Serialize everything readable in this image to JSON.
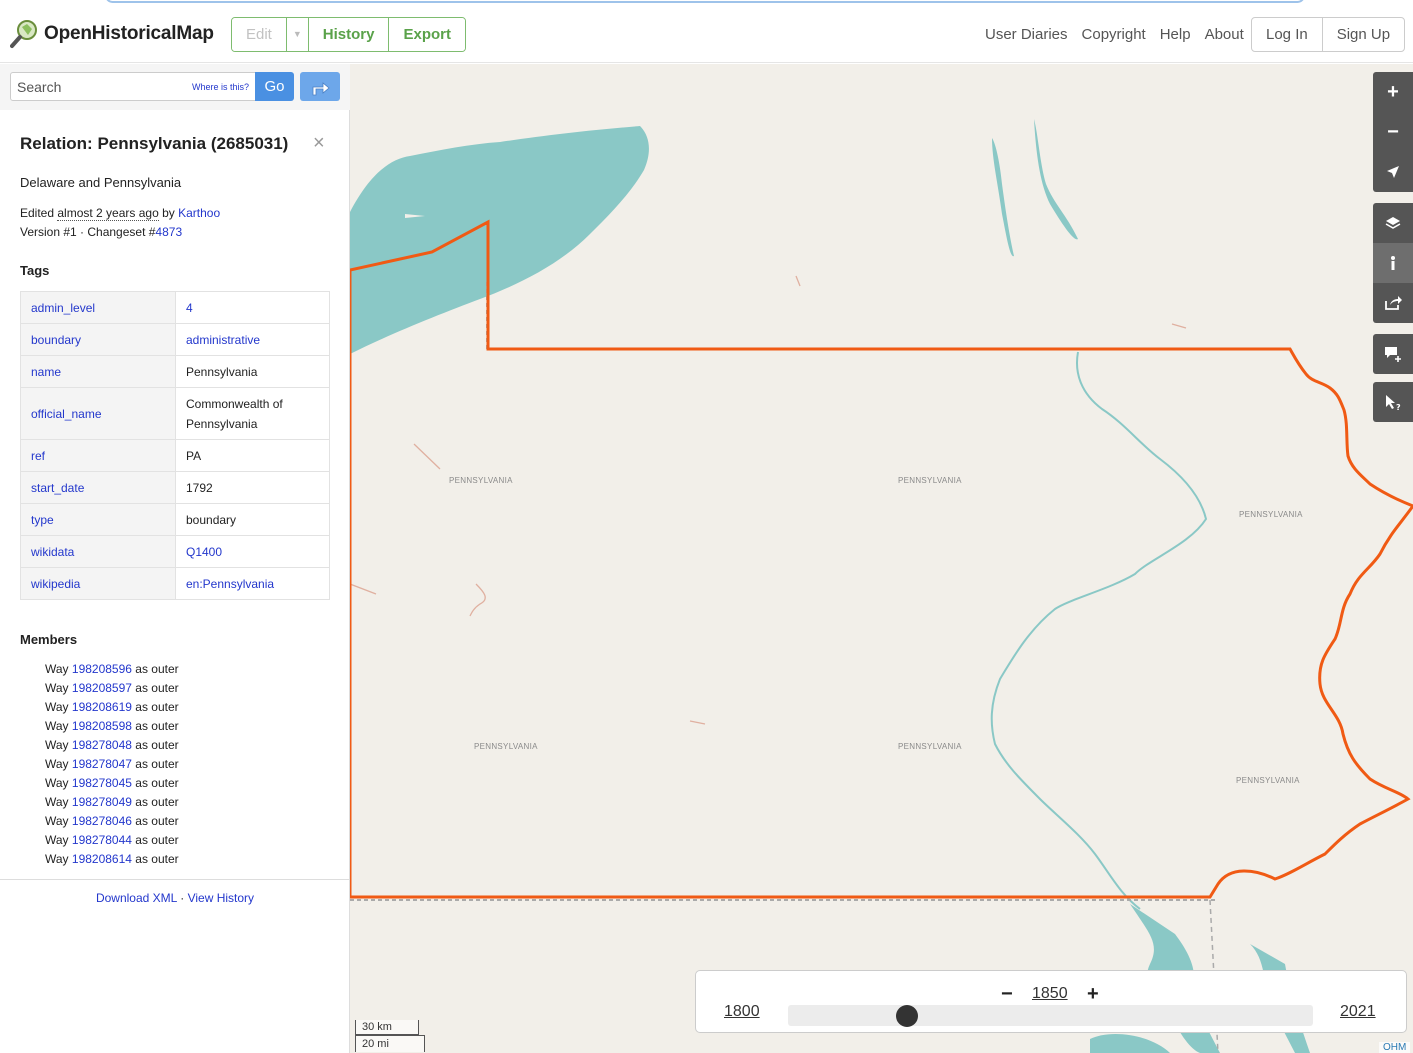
{
  "header": {
    "brand": "OpenHistoricalMap",
    "edit_label": "Edit",
    "history_label": "History",
    "export_label": "Export",
    "nav": [
      "User Diaries",
      "Copyright",
      "Help",
      "About"
    ],
    "login_label": "Log In",
    "signup_label": "Sign Up"
  },
  "search": {
    "placeholder": "Search",
    "where_label": "Where is this?",
    "go_label": "Go"
  },
  "relation": {
    "title": "Relation: Pennsylvania (2685031)",
    "subtitle": "Delaware and Pennsylvania",
    "edited_prefix": "Edited ",
    "edited_when": "almost 2 years ago",
    "edited_by": " by ",
    "editor": "Karthoo",
    "version_text": "Version #1 · Changeset #",
    "changeset": "4873"
  },
  "tags": {
    "heading": "Tags",
    "rows": [
      {
        "key": "admin_level",
        "value": "4",
        "link": true
      },
      {
        "key": "boundary",
        "value": "administrative",
        "link": true
      },
      {
        "key": "name",
        "value": "Pennsylvania",
        "link": false
      },
      {
        "key": "official_name",
        "value": "Commonwealth of Pennsylvania",
        "link": false
      },
      {
        "key": "ref",
        "value": "PA",
        "link": false
      },
      {
        "key": "start_date",
        "value": "1792",
        "link": false
      },
      {
        "key": "type",
        "value": "boundary",
        "link": false
      },
      {
        "key": "wikidata",
        "value": "Q1400",
        "link": true
      },
      {
        "key": "wikipedia",
        "value": "en:Pennsylvania",
        "link": true
      }
    ]
  },
  "members": {
    "heading": "Members",
    "type_label": "Way ",
    "role_label": " as outer",
    "ids": [
      "198208596",
      "198208597",
      "198208619",
      "198208598",
      "198278048",
      "198278047",
      "198278045",
      "198278049",
      "198278046",
      "198278044",
      "198208614"
    ]
  },
  "footer": {
    "download": "Download XML",
    "sep": " · ",
    "history": "View History"
  },
  "map": {
    "labels": [
      "PENNSYLVANIA",
      "PENNSYLVANIA",
      "PENNSYLVANIA",
      "PENNSYLVANIA",
      "PENNSYLVANIA",
      "PENNSYLVANIA"
    ],
    "scale_km": "30 km",
    "scale_mi": "20 mi",
    "attribution": "OHM"
  },
  "timeslider": {
    "minus": "−",
    "plus": "+",
    "current_year": "1850",
    "start_year": "1800",
    "end_year": "2021",
    "position_fraction": 0.2262
  },
  "colors": {
    "boundary": "#f05a14",
    "water": "#8ac8c6",
    "land": "#f2efe9",
    "accent_green": "#7ebc6f",
    "link_blue": "#2337cc"
  }
}
